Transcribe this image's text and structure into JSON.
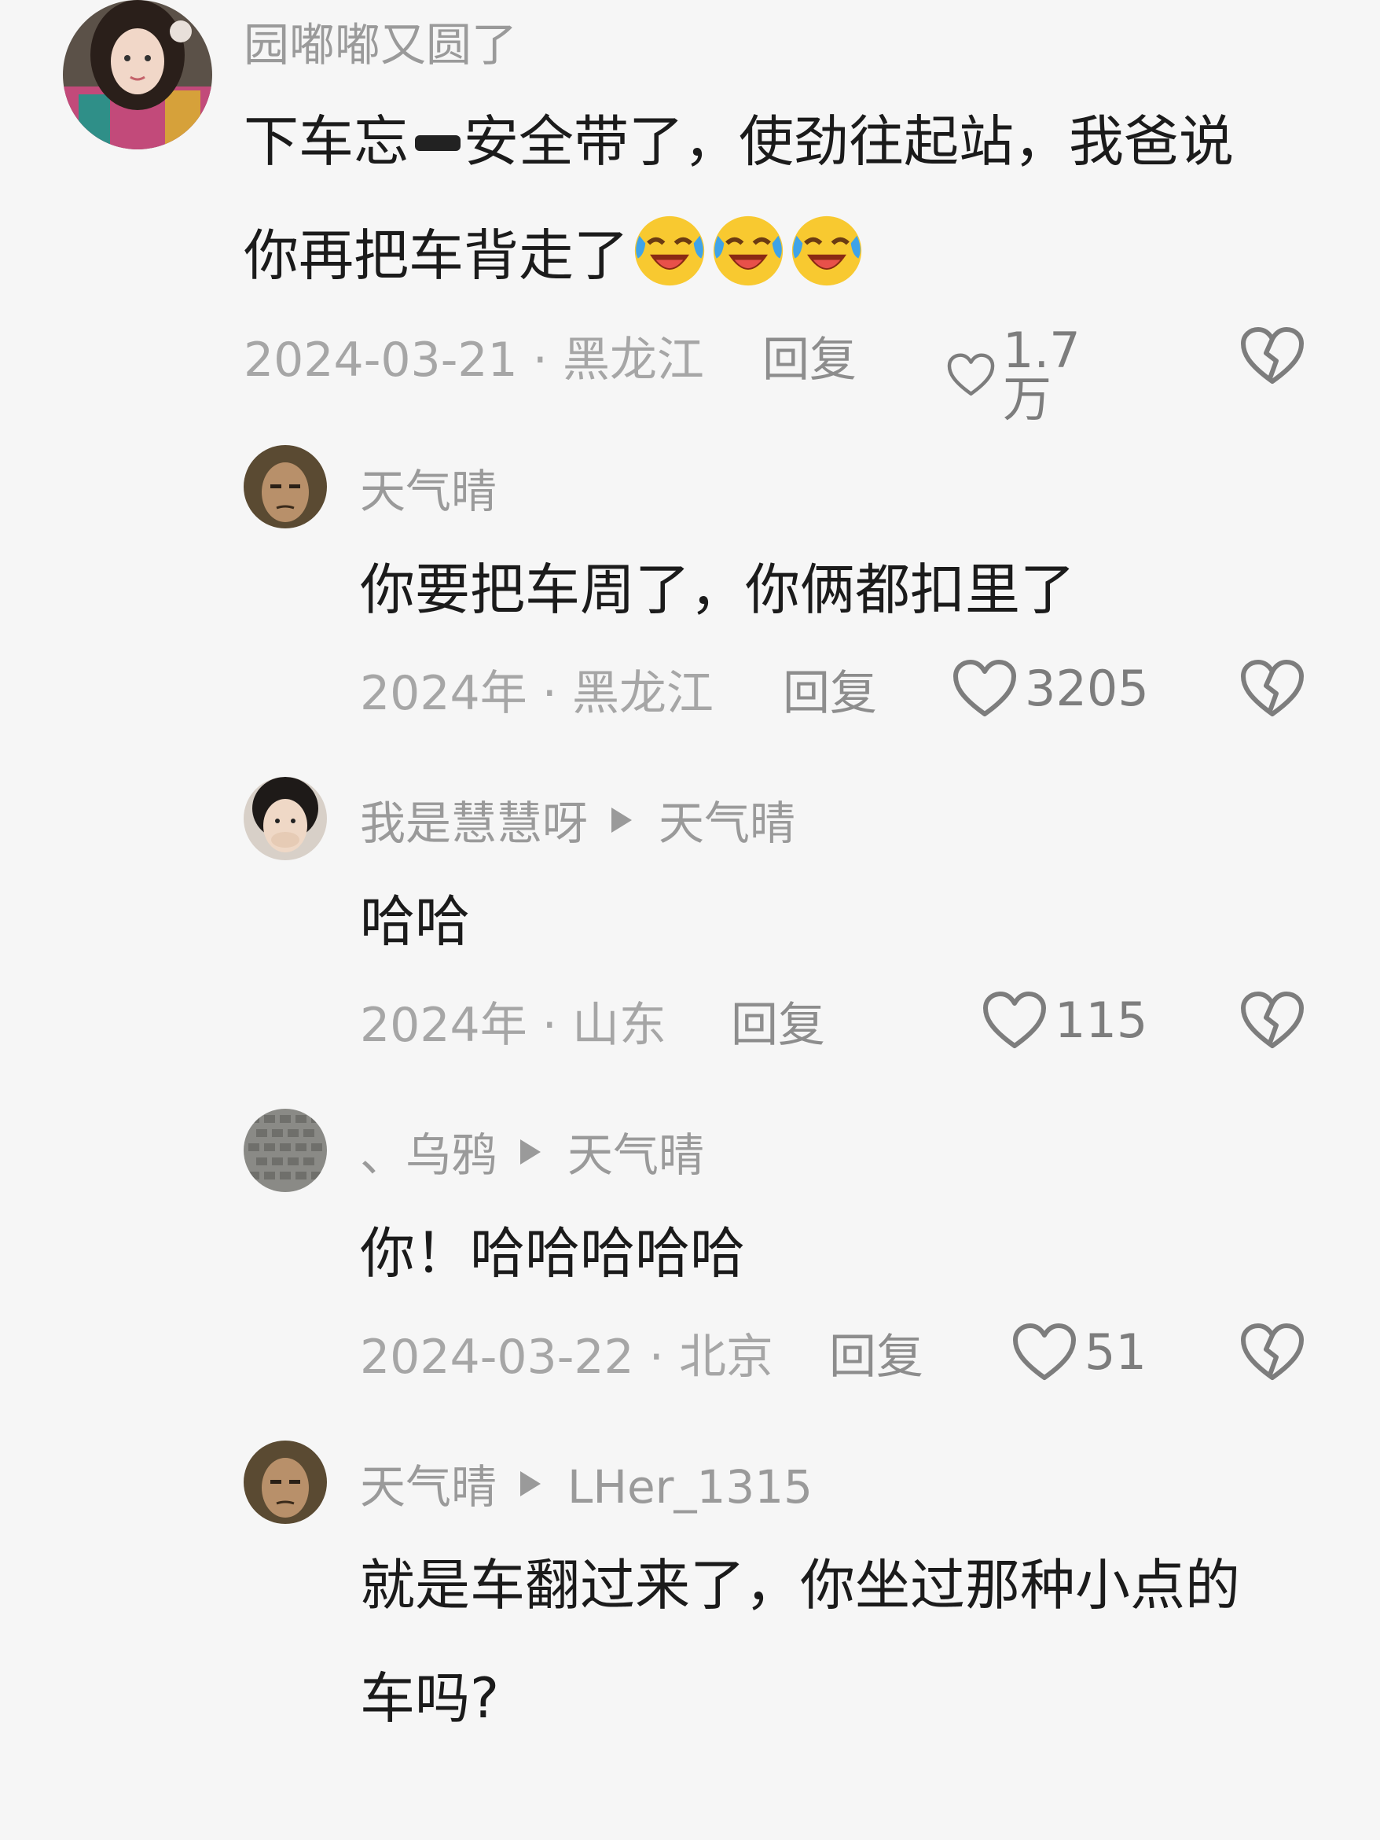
{
  "comments": [
    {
      "author": "园嘟嘟又圆了",
      "line1_a": "下车忘",
      "line1_b": "安全带了，使劲往起站，我爸说",
      "line2": "你再把车背走了",
      "emoji_icon": "laughing-crying-emoji",
      "date": "2024-03-21",
      "location": "黑龙江",
      "reply": "回复",
      "likes": "1.7万"
    },
    {
      "author": "天气晴",
      "text": "你要把车周了，你俩都扣里了",
      "date": "2024年",
      "location": "黑龙江",
      "reply": "回复",
      "likes": "3205"
    },
    {
      "author": "我是慧慧呀",
      "reply_to": "天气晴",
      "text": "哈哈",
      "date": "2024年",
      "location": "山东",
      "reply": "回复",
      "likes": "115"
    },
    {
      "author": "、乌鸦",
      "reply_to": "天气晴",
      "text": "你！哈哈哈哈哈",
      "date": "2024-03-22",
      "location": "北京",
      "reply": "回复",
      "likes": "51"
    },
    {
      "author": "天气晴",
      "reply_to": "LHer_1315",
      "line1": "就是车翻过来了，你坐过那种小点的",
      "line2": "车吗?"
    }
  ],
  "separator": "·",
  "colors": {
    "background": "#f6f6f6",
    "text": "#1b1b1b",
    "muted": "#9a9a9a"
  }
}
